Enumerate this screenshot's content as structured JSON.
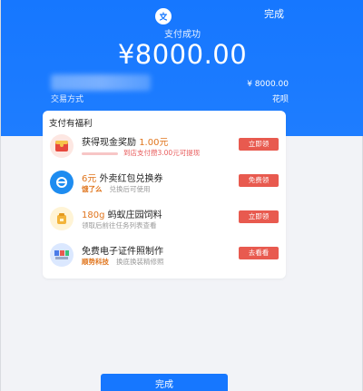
{
  "header": {
    "done_label": "完成",
    "status_text": "支付成功",
    "amount": "¥8000.00",
    "payment_method_label": "交易方式",
    "payment_amount": "¥ 8000.00",
    "payment_channel": "花呗"
  },
  "benefits": {
    "title": "支付有福利",
    "items": [
      {
        "title_prefix": "获得现金奖励",
        "title_value": "1.00元",
        "sub_text": "到店支付攒3.00元可提现",
        "button": "立即领",
        "icon": "red-envelope-icon"
      },
      {
        "title_value": "6元",
        "title_suffix": "外卖红包兑换券",
        "brand": "饿了么",
        "sub_text": "兑换后可使用",
        "button": "免费领",
        "icon": "eleme-icon"
      },
      {
        "title_value": "180g",
        "title_suffix": "蚂蚁庄园饲料",
        "sub_text": "领取后前往任务列表查看",
        "button": "立即领",
        "icon": "feed-bag-icon"
      },
      {
        "title_prefix": "免费电子证件照制作",
        "brand": "顺势科技",
        "sub_text": "换底换装精修照",
        "button": "去看看",
        "icon": "id-photo-icon"
      }
    ]
  },
  "footer": {
    "done_button": "完成"
  },
  "colors": {
    "brand_blue": "#1677ff",
    "button_red": "#e85a4f",
    "highlight_orange": "#e0751d"
  }
}
